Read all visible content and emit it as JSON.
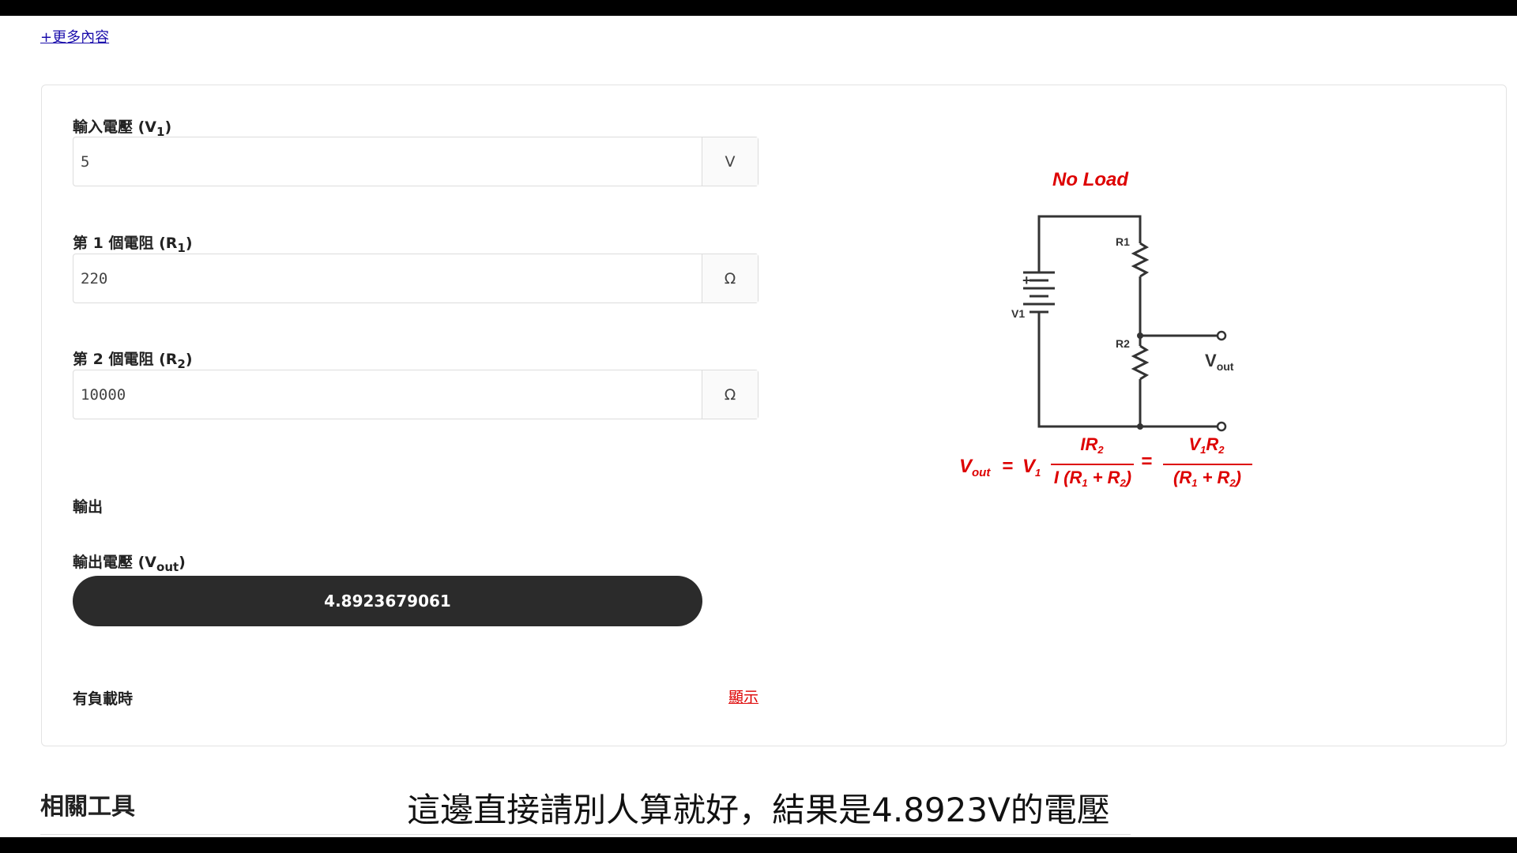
{
  "nav": {
    "more_link": "+更多內容"
  },
  "form": {
    "v1": {
      "label_main": "輸入電壓 (V",
      "label_sub": "1",
      "label_end": ")",
      "value": "5",
      "unit": "V"
    },
    "r1": {
      "label_main": "第 1 個電阻 (R",
      "label_sub": "1",
      "label_end": ")",
      "value": "220",
      "unit": "Ω"
    },
    "r2": {
      "label_main": "第 2 個電阻 (R",
      "label_sub": "2",
      "label_end": ")",
      "value": "10000",
      "unit": "Ω"
    }
  },
  "output": {
    "section_title": "輸出",
    "vout_label_main": "輸出電壓 (V",
    "vout_label_sub": "out",
    "vout_label_end": ")",
    "vout_value": "4.8923679061"
  },
  "load": {
    "label": "有負載時",
    "show_link": "顯示"
  },
  "diagram": {
    "title": "No Load",
    "r1_label": "R1",
    "r2_label": "R2",
    "v1_label": "V1",
    "plus": "+",
    "vout_main": "V",
    "vout_sub": "out",
    "formula": {
      "lhs_main": "V",
      "lhs_sub": "out",
      "eq": "=",
      "v1_main": "V",
      "v1_sub": "1",
      "num1": "IR",
      "num1_sub": "2",
      "den1": "I (R",
      "den1_sub1": "1",
      "den1_mid": " + R",
      "den1_sub2": "2",
      "den1_end": ")",
      "eq2": "=",
      "num2_a": "V",
      "num2_a_sub": "1",
      "num2_b": "R",
      "num2_b_sub": "2",
      "den2": "(R",
      "den2_sub1": "1",
      "den2_mid": " + R",
      "den2_sub2": "2",
      "den2_end": ")"
    }
  },
  "related": {
    "title": "相關工具"
  },
  "subtitle": "這邊直接請別人算就好，結果是4.8923V的電壓",
  "colors": {
    "accent_red": "#dd0000",
    "pill_bg": "#2b2b2b",
    "link_blue": "#1a0dab"
  }
}
